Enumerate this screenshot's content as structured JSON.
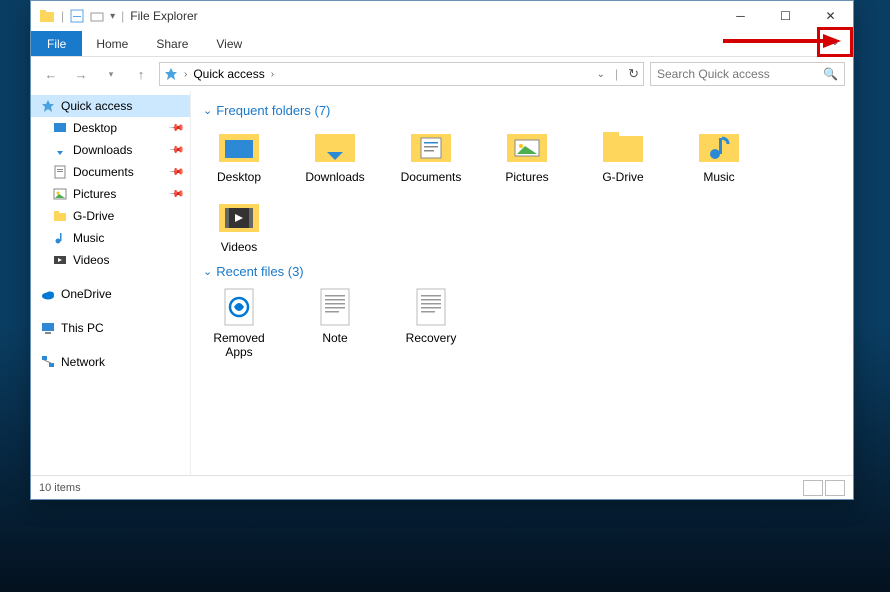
{
  "window_title": "File Explorer",
  "tabs": {
    "file": "File",
    "home": "Home",
    "share": "Share",
    "view": "View"
  },
  "breadcrumb": {
    "root": "Quick access"
  },
  "search": {
    "placeholder": "Search Quick access"
  },
  "sidebar": {
    "quick_access": "Quick access",
    "items": [
      {
        "label": "Desktop",
        "pinned": true
      },
      {
        "label": "Downloads",
        "pinned": true
      },
      {
        "label": "Documents",
        "pinned": true
      },
      {
        "label": "Pictures",
        "pinned": true
      },
      {
        "label": "G-Drive",
        "pinned": false
      },
      {
        "label": "Music",
        "pinned": false
      },
      {
        "label": "Videos",
        "pinned": false
      }
    ],
    "onedrive": "OneDrive",
    "thispc": "This PC",
    "network": "Network"
  },
  "sections": {
    "frequent": {
      "title": "Frequent folders (7)",
      "items": [
        "Desktop",
        "Downloads",
        "Documents",
        "Pictures",
        "G-Drive",
        "Music",
        "Videos"
      ]
    },
    "recent": {
      "title": "Recent files (3)",
      "items": [
        "Removed Apps",
        "Note",
        "Recovery"
      ]
    }
  },
  "statusbar": {
    "count": "10 items"
  }
}
